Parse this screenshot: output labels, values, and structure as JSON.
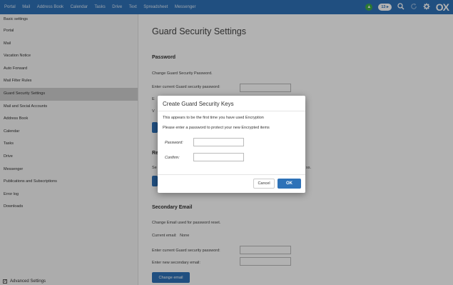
{
  "topbar": {
    "nav": [
      "Portal",
      "Mail",
      "Address Book",
      "Calendar",
      "Tasks",
      "Drive",
      "Text",
      "Spreadsheet",
      "Messenger"
    ],
    "notification_badge": "▲",
    "count_badge": "13",
    "icons": [
      "search-icon",
      "refresh-icon",
      "gear-icon"
    ],
    "logo": "OX"
  },
  "sidebar": {
    "items": [
      "Basic settings",
      "Portal",
      "Mail",
      "Vacation Notice",
      "Auto Forward",
      "Mail Filter Rules",
      "Guard Security Settings",
      "Mail and Social Accounts",
      "Address Book",
      "Calendar",
      "Tasks",
      "Drive",
      "Messenger",
      "Publications and Subscriptions",
      "Error log",
      "Downloads"
    ],
    "selected": "Guard Security Settings",
    "advanced_settings": "Advanced Settings"
  },
  "main": {
    "title": "Guard Security Settings",
    "password_section": {
      "heading": "Password",
      "subtitle": "Change Guard Security Password.",
      "current_label": "Enter current Guard security password:"
    },
    "partial_texts": {
      "e": "E",
      "v": "V",
      "re": "Re",
      "se": "Se",
      "ss": "ss."
    },
    "secondary_section": {
      "heading": "Secondary Email",
      "subtitle": "Change Email used for password reset.",
      "current_email_label": "Current email:",
      "current_email_value": "None",
      "current_password_label": "Enter current Guard security password:",
      "new_email_label": "Enter new secondary email:",
      "change_button": "Change email"
    }
  },
  "dialog": {
    "title": "Create Guard Security Keys",
    "line1": "This appears to be the first time you have used Encryption",
    "line2": "Please enter a password to protect your new Encrypted items",
    "password_label": "Password:",
    "confirm_label": "Confirm:",
    "cancel": "Cancel",
    "ok": "OK"
  },
  "colors": {
    "accent": "#2e72b8",
    "selected_sidebar": "#cfcfcf",
    "notification_green": "#3fae49"
  }
}
